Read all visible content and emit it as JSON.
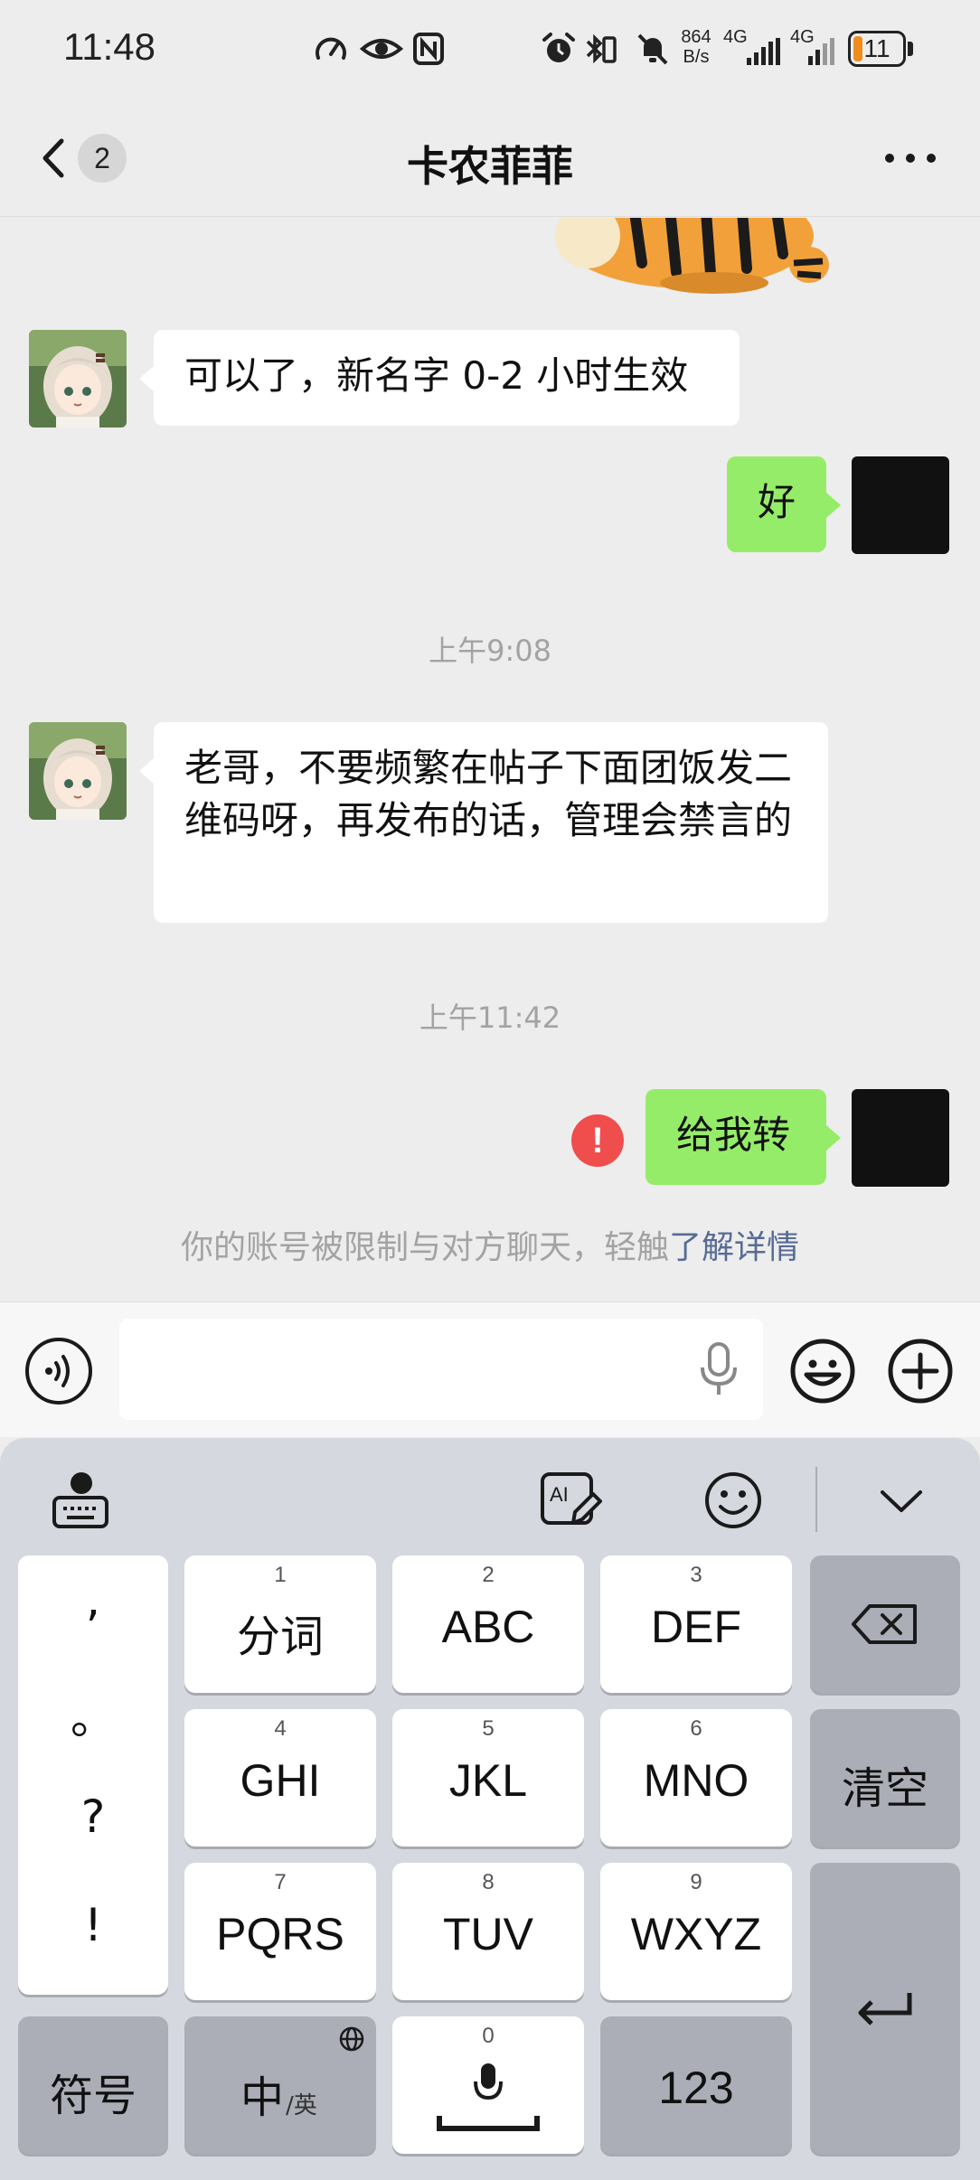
{
  "status_bar": {
    "time": "11:48",
    "net_speed_value": "864",
    "net_speed_unit": "B/s",
    "network_1": "4G",
    "network_2": "4G",
    "battery": "11",
    "battery_color": "#f08c1d"
  },
  "nav": {
    "unread_count": "2",
    "title": "卡农菲菲"
  },
  "messages": {
    "msg1": "可以了，新名字 0-2 小时生效",
    "msg2": "好",
    "time1": "上午9:08",
    "msg3": "老哥，不要频繁在帖子下面团饭发二维码呀，再发布的话，管理会禁言的",
    "time2": "上午11:42",
    "msg4": "给我转",
    "fail_mark": "!",
    "system_note": "你的账号被限制与对方聊天，轻触",
    "system_link": "了解详情"
  },
  "input": {
    "value": "",
    "placeholder": ""
  },
  "keyboard": {
    "punct": [
      ",",
      "。",
      "?",
      "!"
    ],
    "keys": [
      {
        "num": "1",
        "label": "分词"
      },
      {
        "num": "2",
        "label": "ABC"
      },
      {
        "num": "3",
        "label": "DEF"
      },
      {
        "num": "4",
        "label": "GHI"
      },
      {
        "num": "5",
        "label": "JKL"
      },
      {
        "num": "6",
        "label": "MNO"
      },
      {
        "num": "7",
        "label": "PQRS"
      },
      {
        "num": "8",
        "label": "TUV"
      },
      {
        "num": "9",
        "label": "WXYZ"
      }
    ],
    "clear": "清空",
    "symbols": "符号",
    "lang_main": "中",
    "lang_sub": "/英",
    "space_num": "0",
    "numbers": "123"
  },
  "colors": {
    "outgoing_bubble": "#95ec69",
    "incoming_bubble": "#ffffff",
    "link": "#576b95",
    "error": "#f04d4d"
  }
}
